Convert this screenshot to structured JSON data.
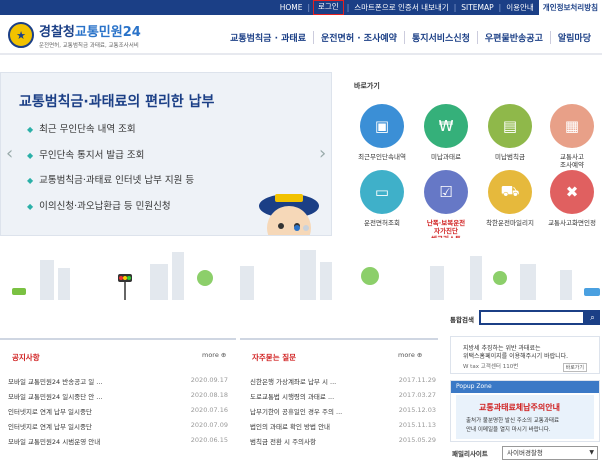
{
  "topbar": {
    "home": "HOME",
    "login": "로그인",
    "smartphone": "스마트폰으로 인증서 내보내기",
    "sitemap": "SITEMAP",
    "guide": "이용안내",
    "private": "개인정보처리방침"
  },
  "logo": {
    "main_a": "경찰청",
    "main_b": "교통민원24",
    "sub": "운전면허, 교통범칙금 과태료, 교통조사서비"
  },
  "gnb": [
    "교통범칙금 · 과태료",
    "운전면허 · 조사예약",
    "통지서비스신청",
    "우편물반송공고",
    "알림마당"
  ],
  "hero": {
    "title": "교통범칙금·과태료의 편리한 납부",
    "items": [
      "최근 무인단속 내역 조회",
      "무인단속 통지서 발급 조회",
      "교통범칙금·과태료 인터넷 납부 지원 등",
      "이의신청·과오납환급 등 민원신청"
    ]
  },
  "quick": {
    "title": "바로가기",
    "items": [
      {
        "label": "최근무인단속내역",
        "color": "#3b8fd6",
        "icon": "camera-icon"
      },
      {
        "label": "미납과태료",
        "color": "#35b07a",
        "icon": "money-icon"
      },
      {
        "label": "미납범칙금",
        "color": "#8fb84a",
        "icon": "receipt-icon"
      },
      {
        "label": "교통사고\n조사예약",
        "color": "#e8a088",
        "icon": "calendar-icon"
      },
      {
        "label": "운전면허조회",
        "color": "#3fb0c9",
        "icon": "license-icon"
      },
      {
        "label": "난폭·보복운전\n자가진단\n체크리스트",
        "color": "#6678c6",
        "icon": "checklist-icon",
        "red": true
      },
      {
        "label": "착한운전마일리지",
        "color": "#e6b93c",
        "icon": "car-icon"
      },
      {
        "label": "교통사고화면인정",
        "color": "#e06060",
        "icon": "accident-icon"
      }
    ]
  },
  "search": {
    "label": "통합검색"
  },
  "notice": {
    "title": "공지사항",
    "more": "more",
    "items": [
      {
        "text": "모바일 교통민원24 반송공고 일 ...",
        "date": "2020.09.17"
      },
      {
        "text": "모바일 교통민원24 일시중단 안 ...",
        "date": "2020.08.18"
      },
      {
        "text": "인터넷지로 연계 납부 일시중단",
        "date": "2020.07.16"
      },
      {
        "text": "인터넷지로 연계 납부 일시중단",
        "date": "2020.07.09"
      },
      {
        "text": "모바일 교통민원24 시범운영 안내",
        "date": "2020.06.15"
      }
    ]
  },
  "faq": {
    "title": "자주묻는 질문",
    "more": "more",
    "items": [
      {
        "text": "신한은행 가상계좌로 납부 시 ...",
        "date": "2017.11.29"
      },
      {
        "text": "도로교통법 시행령의 과태료 ...",
        "date": "2017.03.27"
      },
      {
        "text": "납부기한이 공휴일인 경우 주의 ...",
        "date": "2015.12.03"
      },
      {
        "text": "법인의 과태료 확인 방법 안내",
        "date": "2015.11.13"
      },
      {
        "text": "범칙금 전환 시 주의사항",
        "date": "2015.05.29"
      }
    ]
  },
  "banner": {
    "line1a": "지방세 추징하는 위반 과태료는",
    "line2": "위택스홈페이지를 이용해주시기 바랍니다.",
    "line3": "W tax 고객센터 110번",
    "btn": "바로가기"
  },
  "popup": {
    "header": "Popup Zone",
    "title": "교통과태료체납주의안내",
    "line1": "출처가 불분명한 발신 주소의 교통과태료",
    "line2": "안내 이메일을 열지 마시기 바랍니다."
  },
  "family": {
    "label": "패밀리사이트",
    "select": "사이버경찰청"
  }
}
